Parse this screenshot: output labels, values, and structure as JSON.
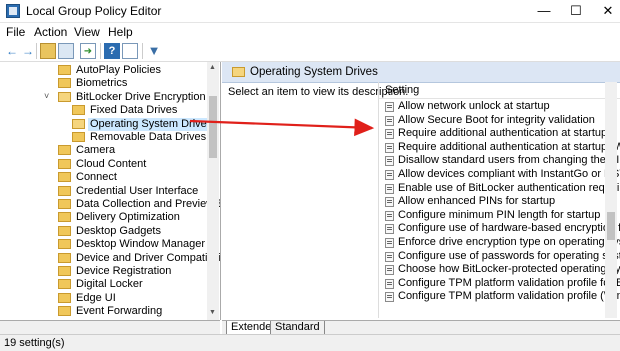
{
  "window": {
    "title": "Local Group Policy Editor",
    "minimize": "—",
    "maximize": "☐",
    "close": "✕"
  },
  "menu": [
    "File",
    "Action",
    "View",
    "Help"
  ],
  "toolbar": {
    "back": "←",
    "forward": "→",
    "help": "?",
    "filter": "▼"
  },
  "tree": [
    {
      "label": "AutoPlay Policies",
      "level": 2
    },
    {
      "label": "Biometrics",
      "level": 2
    },
    {
      "label": "BitLocker Drive Encryption",
      "level": 2,
      "expanded": true
    },
    {
      "label": "Fixed Data Drives",
      "level": 3
    },
    {
      "label": "Operating System Drives",
      "level": 3,
      "selected": true
    },
    {
      "label": "Removable Data Drives",
      "level": 3
    },
    {
      "label": "Camera",
      "level": 2
    },
    {
      "label": "Cloud Content",
      "level": 2
    },
    {
      "label": "Connect",
      "level": 2
    },
    {
      "label": "Credential User Interface",
      "level": 2
    },
    {
      "label": "Data Collection and Preview Builds",
      "level": 2
    },
    {
      "label": "Delivery Optimization",
      "level": 2
    },
    {
      "label": "Desktop Gadgets",
      "level": 2
    },
    {
      "label": "Desktop Window Manager",
      "level": 2
    },
    {
      "label": "Device and Driver Compatibility",
      "level": 2
    },
    {
      "label": "Device Registration",
      "level": 2
    },
    {
      "label": "Digital Locker",
      "level": 2
    },
    {
      "label": "Edge UI",
      "level": 2
    },
    {
      "label": "Event Forwarding",
      "level": 2
    },
    {
      "label": "Event Log Service",
      "level": 2
    }
  ],
  "right": {
    "header": "Operating System Drives",
    "description": "Select an item to view its description.",
    "column": "Setting",
    "settings": [
      "Allow network unlock at startup",
      "Allow Secure Boot for integrity validation",
      "Require additional authentication at startup",
      "Require additional authentication at startup (Windows Server 2008 and Windows Vista)",
      "Disallow standard users from changing the PIN or password",
      "Allow devices compliant with InstantGo or HSTI to opt out of pre-boot PIN",
      "Enable use of BitLocker authentication requiring preboot keyboard input on slates",
      "Allow enhanced PINs for startup",
      "Configure minimum PIN length for startup",
      "Configure use of hardware-based encryption for operating system drives",
      "Enforce drive encryption type on operating system drives",
      "Configure use of passwords for operating system drives",
      "Choose how BitLocker-protected operating system drives can be recovered",
      "Configure TPM platform validation profile for BIOS-based firmware configurations",
      "Configure TPM platform validation profile (Windows Vista, Windows Server 2008, Windows 7, Windows Server 2008 R2)"
    ]
  },
  "tabs": [
    "Extended",
    "Standard"
  ],
  "status": "19 setting(s)",
  "colors": {
    "selection": "#cce8ff",
    "header": "#dce6f4",
    "arrow": "#e0201a"
  }
}
